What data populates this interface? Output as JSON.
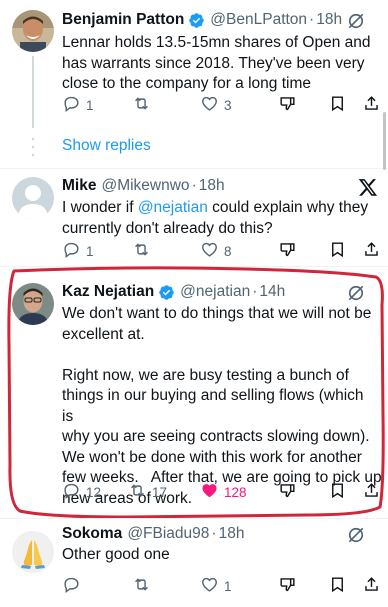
{
  "tweets": [
    {
      "display_name": "Benjamin Patton",
      "handle": "@BenLPatton",
      "time": "18h",
      "lines": [
        "Lennar holds 13.5-15mn shares of Open and",
        "has warrants since 2018. They've been very",
        "close to the company for a long time"
      ],
      "replies": "1",
      "retweets": "",
      "likes": "3",
      "verified": true,
      "avatar": "man-smiling-photo"
    },
    {
      "display_name": "Mike",
      "handle": "@Mikewnwo",
      "time": "18h",
      "line1_pre": "I wonder if ",
      "line1_mention": "@nejatian",
      "line1_post": " could explain why they",
      "line2": "currently don't already do this?",
      "replies": "1",
      "retweets": "",
      "likes": "8",
      "verified": false,
      "avatar": "default-avatar"
    },
    {
      "display_name": "Kaz Nejatian",
      "handle": "@nejatian",
      "time": "14h",
      "lines": [
        "We don't want to do things that we will not be",
        "excellent at.",
        "",
        "Right now, we are busy testing a bunch of",
        "things in our buying and selling flows (which is",
        "why you are seeing contracts slowing down).",
        "We won't be done with this work for another",
        "few weeks.   After that, we are going to pick up",
        "new areas of work."
      ],
      "replies": "12",
      "retweets": "17",
      "likes": "128",
      "verified": true,
      "avatar": "man-glasses-photo"
    },
    {
      "display_name": "Sokoma",
      "handle": "@FBiadu98",
      "time": "18h",
      "lines": [
        "Other good one"
      ],
      "replies": "",
      "retweets": "",
      "likes": "1",
      "verified": false,
      "avatar": "praying-hands-emoji"
    }
  ],
  "show_replies_label": "Show replies",
  "colors": {
    "accent": "#1d9bf0",
    "like_active": "#f91880",
    "secondary_text": "#536471",
    "highlight_outline": "#d0263a"
  }
}
